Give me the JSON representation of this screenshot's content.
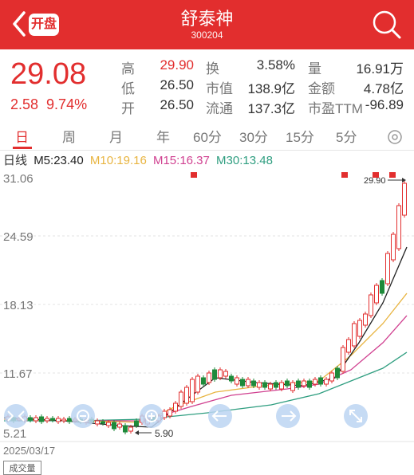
{
  "header": {
    "open_badge": "开盘",
    "name": "舒泰神",
    "code": "300204"
  },
  "quote": {
    "price": "29.08",
    "change": "2.58",
    "change_pct": "9.74%",
    "stats": [
      {
        "label": "高",
        "value": "29.90",
        "color": "red"
      },
      {
        "label": "换",
        "value": "3.58%",
        "color": "normal"
      },
      {
        "label": "量",
        "value": "16.91万",
        "color": "normal"
      },
      {
        "label": "低",
        "value": "26.50",
        "color": "normal"
      },
      {
        "label": "市值",
        "value": "138.9亿",
        "color": "normal"
      },
      {
        "label": "金额",
        "value": "4.78亿",
        "color": "normal"
      },
      {
        "label": "开",
        "value": "26.50",
        "color": "normal"
      },
      {
        "label": "流通",
        "value": "137.3亿",
        "color": "normal"
      },
      {
        "label": "市盈TTM",
        "value": "-96.89",
        "color": "normal"
      }
    ]
  },
  "tabs": [
    "日",
    "周",
    "月",
    "年",
    "60分",
    "30分",
    "15分",
    "5分"
  ],
  "ma": {
    "title": "日线",
    "m5": "M5:23.40",
    "m10": "M10:19.16",
    "m15": "M15:16.37",
    "m30": "M30:13.48"
  },
  "axis": {
    "t1": "31.06",
    "t2": "24.59",
    "t3": "18.13",
    "t4": "11.67",
    "t5": "5.21"
  },
  "annotations": {
    "high": "29.90",
    "low": "5.90"
  },
  "date": "2025/03/17",
  "footer": "成交量",
  "colors": {
    "accent": "#e22e2e",
    "up": "#e22e2e",
    "down": "#1e8a3a",
    "ma5": "#222222",
    "ma10": "#e8b440",
    "ma15": "#d04090",
    "ma30": "#2f9e80"
  }
}
